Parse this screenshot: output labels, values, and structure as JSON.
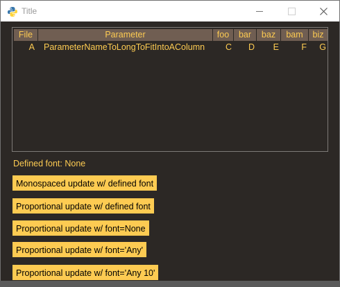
{
  "window": {
    "title": "Title"
  },
  "table": {
    "headers": [
      "File",
      "Parameter",
      "foo",
      "bar",
      "baz",
      "bam",
      "biz"
    ],
    "rows": [
      [
        "A",
        "ParameterNameToLongToFitIntoAColumn",
        "C",
        "D",
        "E",
        "F",
        "G"
      ]
    ]
  },
  "defined_font_text": "Defined font: None",
  "buttons": [
    "Monospaced update w/ defined font",
    "Proportional update w/ defined font",
    "Proportional update w/ font=None",
    "Proportional update w/ font='Any'",
    "Proportional update w/ font='Any 10'"
  ],
  "colors": {
    "background": "#2c2825",
    "accent_text": "#fdcb52",
    "header_bg": "#705e52",
    "button_bg": "#fdcb52"
  },
  "icons": [
    "python-icon",
    "minimize-icon",
    "maximize-icon",
    "close-icon"
  ]
}
